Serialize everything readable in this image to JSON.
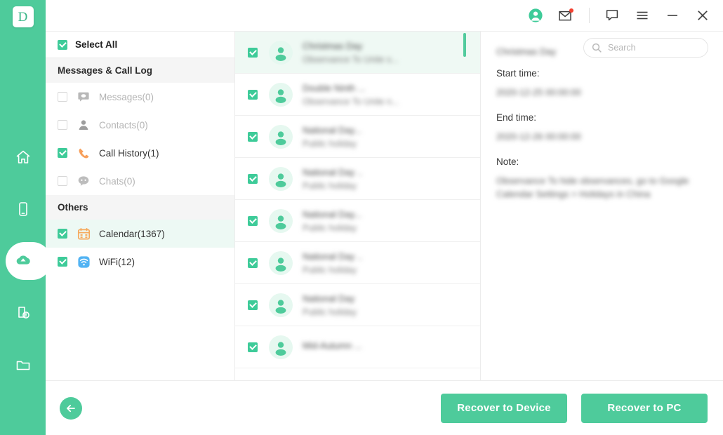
{
  "app": {
    "logo_letter": "D",
    "accent": "#4ecb9b",
    "accent_light": "#eff9f4",
    "alert_dot": "#f3402f"
  },
  "rail": {
    "items": [
      {
        "name": "home",
        "icon": "home-icon",
        "active": false
      },
      {
        "name": "device",
        "icon": "phone-icon",
        "active": false
      },
      {
        "name": "recover",
        "icon": "cloud-recover-icon",
        "active": true
      },
      {
        "name": "repair",
        "icon": "device-repair-icon",
        "active": false
      },
      {
        "name": "files",
        "icon": "folder-icon",
        "active": false
      }
    ]
  },
  "titlebar": {
    "icons": [
      {
        "name": "account-icon",
        "glyph": "account"
      },
      {
        "name": "mail-icon",
        "glyph": "mail",
        "badge": true
      },
      {
        "name": "feedback-icon",
        "glyph": "chat"
      },
      {
        "name": "menu-icon",
        "glyph": "hamburger"
      },
      {
        "name": "minimize-icon",
        "glyph": "minimize"
      },
      {
        "name": "close-icon",
        "glyph": "close"
      }
    ]
  },
  "search": {
    "placeholder": "Search",
    "value": ""
  },
  "categories": {
    "select_all_label": "Select All",
    "select_all_checked": true,
    "groups": [
      {
        "title": "Messages & Call Log",
        "items": [
          {
            "label": "Messages(0)",
            "icon": "message-icon",
            "checked": false,
            "enabled": false,
            "selected": false
          },
          {
            "label": "Contacts(0)",
            "icon": "contact-icon",
            "checked": false,
            "enabled": false,
            "selected": false
          },
          {
            "label": "Call History(1)",
            "icon": "phone-call-icon",
            "checked": true,
            "enabled": true,
            "selected": false
          },
          {
            "label": "Chats(0)",
            "icon": "chats-icon",
            "checked": false,
            "enabled": false,
            "selected": false
          }
        ]
      },
      {
        "title": "Others",
        "items": [
          {
            "label": "Calendar(1367)",
            "icon": "calendar-icon",
            "checked": true,
            "enabled": true,
            "selected": true
          },
          {
            "label": "WiFi(12)",
            "icon": "wifi-icon",
            "checked": true,
            "enabled": true,
            "selected": false
          }
        ]
      }
    ]
  },
  "list": {
    "scroll_position": "top",
    "rows": [
      {
        "title": "Christmas Day",
        "subtitle": "Observance To Unite s...",
        "checked": true,
        "selected": true
      },
      {
        "title": "Double Ninth ...",
        "subtitle": "Observance To Unite n...",
        "checked": true,
        "selected": false
      },
      {
        "title": "National Day...",
        "subtitle": "Public holiday",
        "checked": true,
        "selected": false
      },
      {
        "title": "National Day ..",
        "subtitle": "Public holiday",
        "checked": true,
        "selected": false
      },
      {
        "title": "National Day...",
        "subtitle": "Public holiday",
        "checked": true,
        "selected": false
      },
      {
        "title": "National Day ..",
        "subtitle": "Public holiday",
        "checked": true,
        "selected": false
      },
      {
        "title": "National Day",
        "subtitle": "Public holiday",
        "checked": true,
        "selected": false
      },
      {
        "title": "Mid-Autumn ...",
        "subtitle": "",
        "checked": true,
        "selected": false
      }
    ]
  },
  "detail": {
    "title": "Christmas Day",
    "fields": [
      {
        "label": "Start time:",
        "value": "2020-12-25 00:00:00"
      },
      {
        "label": "End time:",
        "value": "2020-12-26 00:00:00"
      },
      {
        "label": "Note:",
        "value": "Observance\nTo hide observances, go to Google Calendar Settings > Holidays in China"
      }
    ]
  },
  "footer": {
    "back_label": "back-arrow",
    "recover_device_label": "Recover to Device",
    "recover_pc_label": "Recover to PC"
  }
}
